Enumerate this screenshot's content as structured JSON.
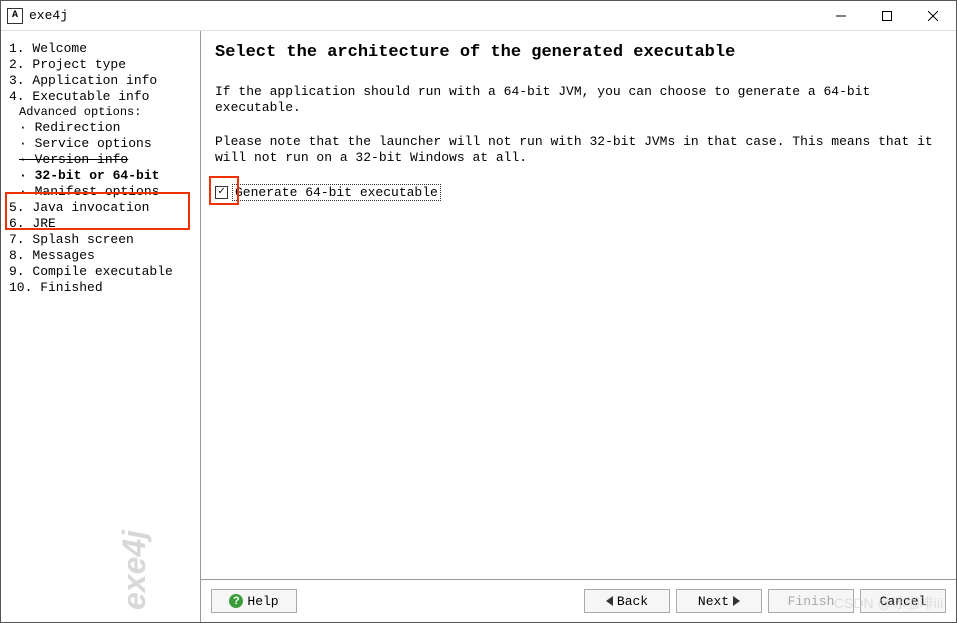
{
  "window": {
    "icon_char": "A",
    "title": "exe4j"
  },
  "nav": {
    "items": [
      {
        "label": "1. Welcome"
      },
      {
        "label": "2. Project type"
      },
      {
        "label": "3. Application info"
      },
      {
        "label": "4. Executable info"
      }
    ],
    "adv_header": "Advanced options:",
    "subs": [
      {
        "label": "· Redirection"
      },
      {
        "label": "· Service options"
      },
      {
        "label": "· Version info",
        "strike": true
      },
      {
        "label": "· 32-bit or 64-bit",
        "bold": true
      },
      {
        "label": "· Manifest options"
      }
    ],
    "items2": [
      {
        "label": "5. Java invocation"
      },
      {
        "label": "6. JRE"
      },
      {
        "label": "7. Splash screen"
      },
      {
        "label": "8. Messages"
      },
      {
        "label": "9. Compile executable"
      },
      {
        "label": "10. Finished"
      }
    ],
    "logo": "exe4j"
  },
  "main": {
    "heading": "Select the architecture of the generated executable",
    "p1": "If the application should run with a 64-bit JVM, you can choose to generate a 64-bit executable.",
    "p2": "Please note that the launcher will not run with 32-bit JVMs in that case. This means that it will not run on a 32-bit Windows at all.",
    "checkbox_label": "Generate 64-bit executable",
    "checkbox_checked": "✓"
  },
  "footer": {
    "help": "Help",
    "back": "Back",
    "next": "Next",
    "finish": "Finish",
    "cancel": "Cancel"
  },
  "watermark": "CSDN @冰咖啡iii"
}
